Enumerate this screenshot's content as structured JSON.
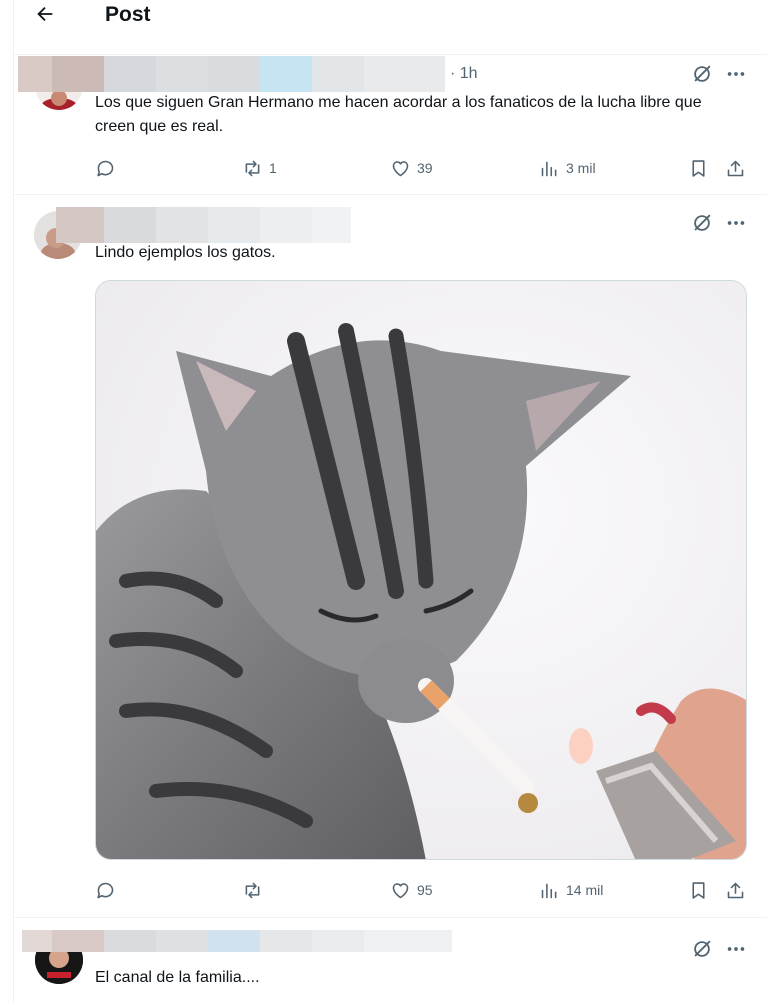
{
  "header": {
    "title": "Post",
    "back_icon": "arrow-left-icon"
  },
  "posts": [
    {
      "time": "· 1h",
      "text": "Los que siguen Gran Hermano me hacen acordar a los fanaticos de la lucha libre que creen que es real.",
      "replies": "",
      "reposts": "1",
      "likes": "39",
      "views": "3 mil"
    },
    {
      "text": "Lindo ejemplos los gatos.",
      "media": "kitten-with-cigarette-image",
      "replies": "",
      "reposts": "",
      "likes": "95",
      "views": "14 mil"
    },
    {
      "text": "El canal de la familia...."
    }
  ],
  "icons": {
    "reply": "speech-bubble-icon",
    "repost": "repost-arrows-icon",
    "like": "heart-icon",
    "views": "bar-chart-icon",
    "bookmark": "bookmark-icon",
    "share": "share-upload-icon",
    "grok": "grok-slash-icon",
    "more": "more-dots-icon"
  },
  "colors": {
    "icon_gray": "#536471",
    "text": "#0f1419",
    "divider": "#eff3f4",
    "verified": "#1d9bf0"
  }
}
